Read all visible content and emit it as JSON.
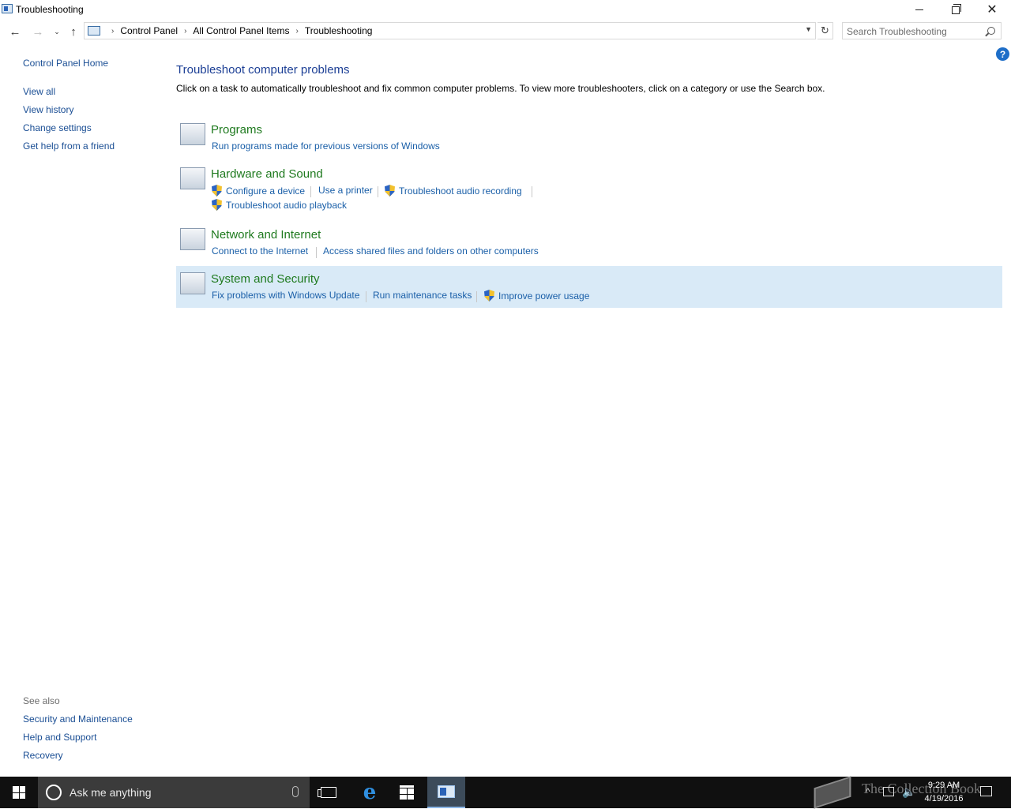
{
  "window": {
    "title": "Troubleshooting",
    "minimize": "",
    "close": "✕"
  },
  "navigation": {
    "back": "←",
    "forward": "→",
    "recent": "⌄",
    "up": "↑",
    "breadcrumbs": [
      "Control Panel",
      "All Control Panel Items",
      "Troubleshooting"
    ],
    "refresh": "↻",
    "search_placeholder": "Search Troubleshooting"
  },
  "help": "?",
  "sidebar": {
    "home": "Control Panel Home",
    "items": [
      {
        "label": "View all"
      },
      {
        "label": "View history"
      },
      {
        "label": "Change settings"
      },
      {
        "label": "Get help from a friend"
      }
    ],
    "see_also_title": "See also",
    "see_also": [
      {
        "label": "Security and Maintenance"
      },
      {
        "label": "Help and Support"
      },
      {
        "label": "Recovery"
      }
    ]
  },
  "main": {
    "title": "Troubleshoot computer problems",
    "description": "Click on a task to automatically troubleshoot and fix common computer problems. To view more troubleshooters, click on a category or use the Search box.",
    "categories": [
      {
        "title": "Programs",
        "icon": "programs-icon",
        "tasks": [
          {
            "label": "Run programs made for previous versions of Windows",
            "shield": false
          }
        ]
      },
      {
        "title": "Hardware and Sound",
        "icon": "hardware-icon",
        "tasks": [
          {
            "label": "Configure a device",
            "shield": true
          },
          {
            "label": "Use a printer",
            "shield": false
          },
          {
            "label": "Troubleshoot audio recording",
            "shield": true
          },
          {
            "label": "Troubleshoot audio playback",
            "shield": true
          }
        ]
      },
      {
        "title": "Network and Internet",
        "icon": "network-icon",
        "tasks": [
          {
            "label": "Connect to the Internet",
            "shield": false
          },
          {
            "label": "Access shared files and folders on other computers",
            "shield": false
          }
        ]
      },
      {
        "title": "System and Security",
        "icon": "system-icon",
        "selected": true,
        "tasks": [
          {
            "label": "Fix problems with Windows Update",
            "shield": false
          },
          {
            "label": "Run maintenance tasks",
            "shield": false
          },
          {
            "label": "Improve power usage",
            "shield": true
          }
        ]
      }
    ]
  },
  "taskbar": {
    "search_placeholder": "Ask me anything",
    "edge_glyph": "e",
    "watermark": "The Collection Book",
    "volume_glyph": "🔈",
    "tray_chevron": "^",
    "time": "9:29 AM",
    "date": "4/19/2016"
  },
  "colors": {
    "link": "#1a4e94",
    "category_title": "#1f7a1f",
    "selected_row": "#d9eaf7",
    "taskbar": "#101010"
  }
}
